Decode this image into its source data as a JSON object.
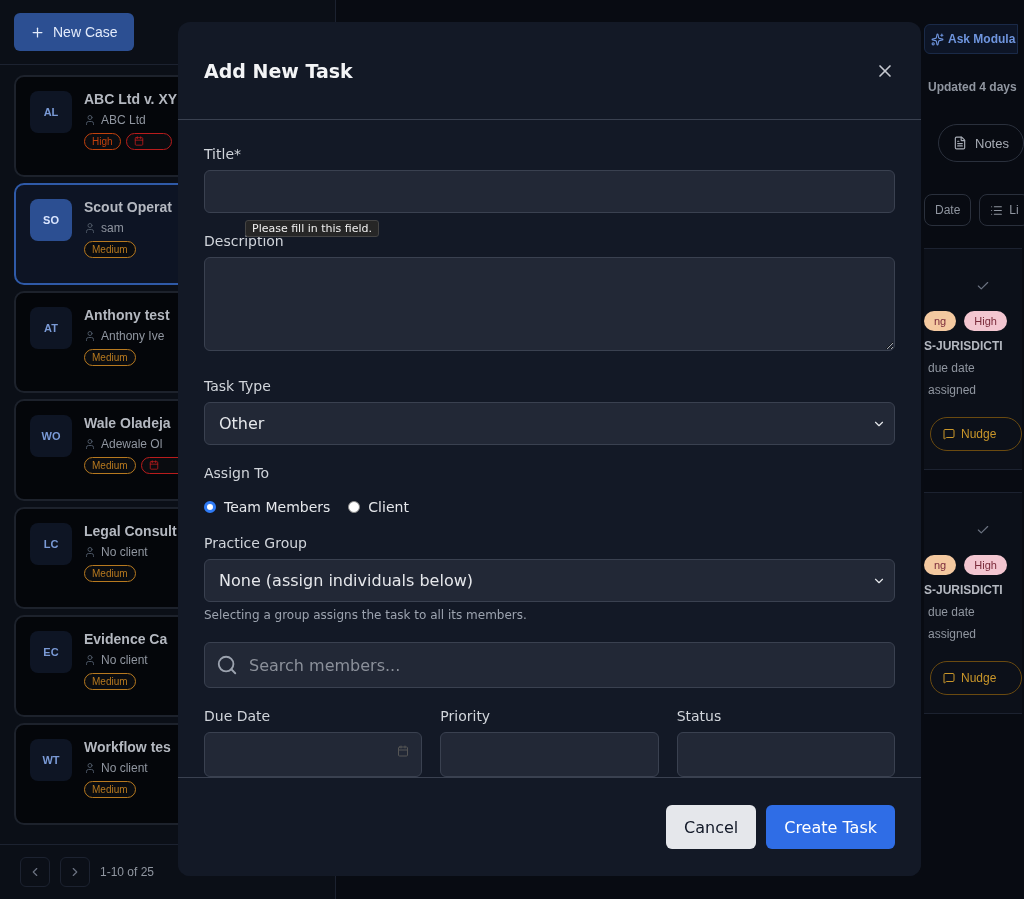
{
  "sidebar": {
    "new_case_button": "New Case",
    "cases": [
      {
        "initials": "AL",
        "title": "ABC Ltd v. XY",
        "client": "ABC Ltd",
        "selected": false,
        "tags": [
          {
            "kind": "priority",
            "label": "High",
            "color": "#c2410c"
          },
          {
            "kind": "alert",
            "color": "#b91c1c"
          }
        ]
      },
      {
        "initials": "SO",
        "title": "Scout Operat",
        "client": "sam",
        "selected": true,
        "tags": [
          {
            "kind": "priority",
            "label": "Medium",
            "color": "#b7791f"
          }
        ]
      },
      {
        "initials": "AT",
        "title": "Anthony test",
        "client": "Anthony Ive",
        "selected": false,
        "tags": [
          {
            "kind": "priority",
            "label": "Medium",
            "color": "#b7791f"
          }
        ]
      },
      {
        "initials": "WO",
        "title": "Wale Oladeja",
        "client": "Adewale Ol",
        "selected": false,
        "tags": [
          {
            "kind": "priority",
            "label": "Medium",
            "color": "#b7791f"
          },
          {
            "kind": "alert",
            "color": "#b91c1c"
          }
        ]
      },
      {
        "initials": "LC",
        "title": "Legal Consult",
        "client": "No client",
        "selected": false,
        "tags": [
          {
            "kind": "priority",
            "label": "Medium",
            "color": "#b7791f"
          }
        ]
      },
      {
        "initials": "EC",
        "title": "Evidence Ca",
        "client": "No client",
        "selected": false,
        "tags": [
          {
            "kind": "priority",
            "label": "Medium",
            "color": "#b7791f"
          }
        ]
      },
      {
        "initials": "WT",
        "title": "Workflow tes",
        "client": "No client",
        "selected": false,
        "tags": [
          {
            "kind": "priority",
            "label": "Medium",
            "color": "#b7791f"
          }
        ]
      }
    ],
    "pagination": "1-10 of 25"
  },
  "main": {
    "ask_button": "Ask Modula",
    "updated": "Updated 4 days",
    "notes_button": "Notes",
    "filters": [
      "Date",
      "Li"
    ],
    "tasks": [
      {
        "tags": [
          {
            "label": "ng",
            "color": "#f4c9a0"
          },
          {
            "label": "High",
            "color": "#f3c6d0"
          }
        ],
        "code": "S-JURISDICTI",
        "lines": [
          "due date",
          "assigned"
        ],
        "nudge": "Nudge"
      },
      {
        "tags": [
          {
            "label": "ng",
            "color": "#f4c9a0"
          },
          {
            "label": "High",
            "color": "#f3c6d0"
          }
        ],
        "code": "S-JURISDICTI",
        "lines": [
          "due date",
          "assigned"
        ],
        "nudge": "Nudge"
      }
    ]
  },
  "dialog": {
    "title": "Add New Task",
    "title_field": {
      "label": "Title*"
    },
    "tooltip": "Please fill in this field.",
    "description_field": {
      "label": "Description"
    },
    "task_type": {
      "label": "Task Type",
      "value": "Other"
    },
    "assign_to": {
      "label": "Assign To",
      "options": [
        {
          "label": "Team Members",
          "selected": true
        },
        {
          "label": "Client",
          "selected": false
        }
      ]
    },
    "practice_group": {
      "label": "Practice Group",
      "value": "None (assign individuals below)",
      "help": "Selecting a group assigns the task to all its members."
    },
    "member_search": {
      "placeholder": "Search members..."
    },
    "bottom_fields": [
      {
        "label": "Due Date",
        "kind": "date"
      },
      {
        "label": "Priority",
        "kind": "select"
      },
      {
        "label": "Status",
        "kind": "select"
      }
    ],
    "buttons": [
      {
        "label": "Cancel",
        "kind": "secondary"
      },
      {
        "label": "Create Task",
        "kind": "primary"
      }
    ]
  }
}
